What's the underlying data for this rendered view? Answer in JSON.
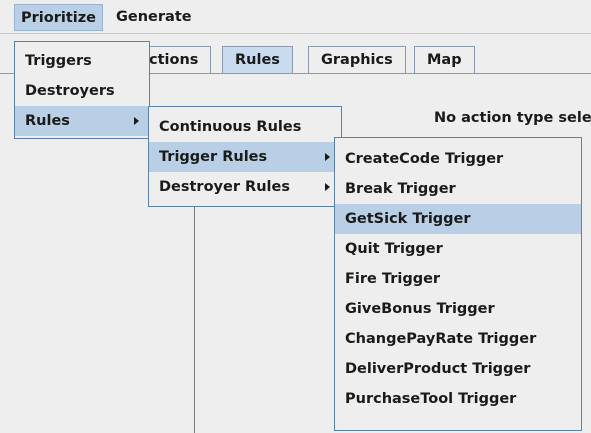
{
  "menubar": {
    "items": [
      {
        "label": "Prioritize",
        "active": true
      },
      {
        "label": "Generate",
        "active": false
      }
    ]
  },
  "tabs": [
    {
      "label": "Actions",
      "visible_label": "ctions"
    },
    {
      "label": "Rules",
      "selected": true
    },
    {
      "label": "Graphics"
    },
    {
      "label": "Map"
    }
  ],
  "content": {
    "status": "No action type sele"
  },
  "prioritize_menu": {
    "items": [
      {
        "label": "Triggers"
      },
      {
        "label": "Destroyers"
      },
      {
        "label": "Rules",
        "submenu": true,
        "highlighted": true
      }
    ]
  },
  "rules_submenu": {
    "items": [
      {
        "label": "Continuous Rules"
      },
      {
        "label": "Trigger Rules",
        "submenu": true,
        "highlighted": true
      },
      {
        "label": "Destroyer Rules",
        "submenu": true
      }
    ]
  },
  "trigger_rules_submenu": {
    "items": [
      {
        "label": "CreateCode Trigger"
      },
      {
        "label": "Break Trigger"
      },
      {
        "label": "GetSick Trigger",
        "highlighted": true
      },
      {
        "label": "Quit Trigger"
      },
      {
        "label": "Fire Trigger"
      },
      {
        "label": "GiveBonus Trigger"
      },
      {
        "label": "ChangePayRate Trigger"
      },
      {
        "label": "DeliverProduct Trigger"
      },
      {
        "label": "PurchaseTool Trigger"
      }
    ]
  },
  "colors": {
    "highlight": "#b8cfe5",
    "menu_bg": "#eeeeee",
    "border": "#5e7fa6"
  }
}
